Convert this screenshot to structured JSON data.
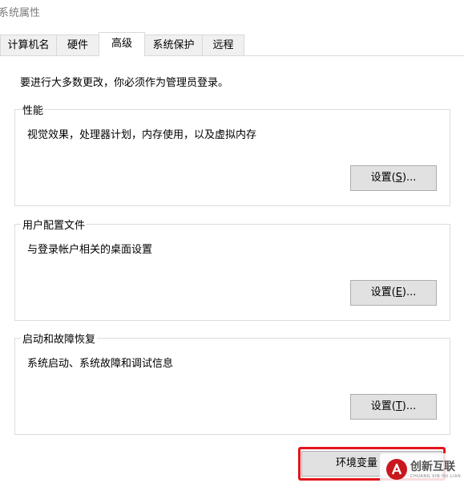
{
  "window": {
    "title": "系统属性"
  },
  "tabs": [
    {
      "label": "计算机名"
    },
    {
      "label": "硬件"
    },
    {
      "label": "高级",
      "active": true
    },
    {
      "label": "系统保护"
    },
    {
      "label": "远程"
    }
  ],
  "notice": "要进行大多数更改，你必须作为管理员登录。",
  "groups": {
    "performance": {
      "title": "性能",
      "description": "视觉效果，处理器计划，内存使用，以及虚拟内存",
      "button": {
        "prefix": "设置(",
        "key": "S",
        "suffix": ")..."
      }
    },
    "user_profiles": {
      "title": "用户配置文件",
      "description": "与登录帐户相关的桌面设置",
      "button": {
        "prefix": "设置(",
        "key": "E",
        "suffix": ")..."
      }
    },
    "startup_recovery": {
      "title": "启动和故障恢复",
      "description": "系统启动、系统故障和调试信息",
      "button": {
        "prefix": "设置(",
        "key": "T",
        "suffix": ")..."
      }
    }
  },
  "env_button": {
    "label": "环境变量"
  },
  "highlight_color": "#e4141c",
  "watermark": {
    "text": "创新互联",
    "sub": "CHUANG XIN HU LIAN",
    "logo_color": "#c9171e",
    "icon": "logo-icon"
  }
}
